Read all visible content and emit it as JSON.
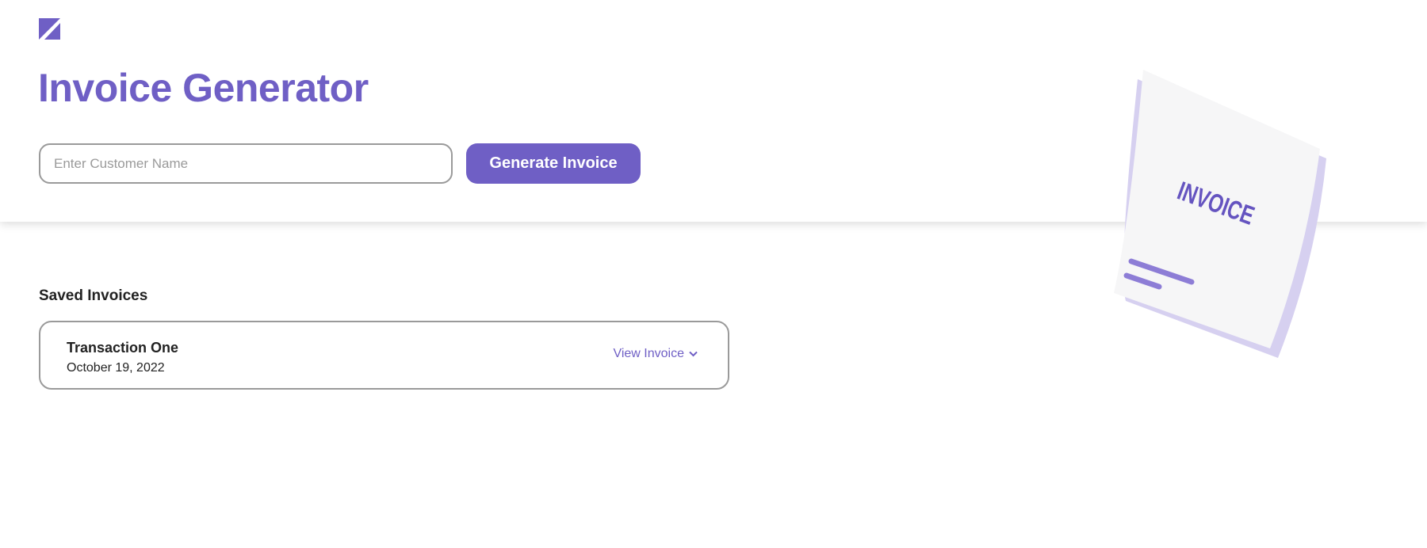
{
  "app": {
    "title": "Invoice Generator",
    "accent": "#6f5fc5"
  },
  "form": {
    "customer_placeholder": "Enter Customer Name",
    "customer_value": "",
    "generate_label": "Generate Invoice"
  },
  "illustration": {
    "label": "INVOICE"
  },
  "saved": {
    "heading": "Saved Invoices",
    "items": [
      {
        "name": "Transaction One",
        "date": "October 19, 2022",
        "action": "View Invoice"
      }
    ]
  }
}
